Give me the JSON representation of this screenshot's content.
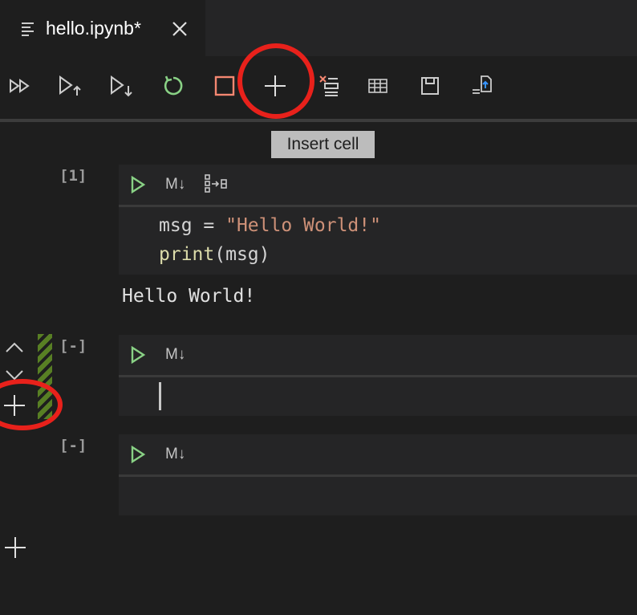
{
  "tab": {
    "title": "hello.ipynb*",
    "icon": "list-lines-icon",
    "close_icon": "close-icon"
  },
  "toolbar": {
    "buttons": [
      {
        "name": "run-all-icon"
      },
      {
        "name": "run-above-icon"
      },
      {
        "name": "run-below-icon"
      },
      {
        "name": "restart-kernel-icon",
        "color": "#89d185"
      },
      {
        "name": "interrupt-kernel-icon",
        "color": "#f48771"
      },
      {
        "name": "insert-cell-icon"
      },
      {
        "name": "clear-outputs-icon"
      },
      {
        "name": "variables-icon"
      },
      {
        "name": "save-icon"
      },
      {
        "name": "export-icon"
      }
    ],
    "tooltip": "Insert cell"
  },
  "cells": [
    {
      "exec_count": "[1]",
      "markdown_toggle": "M↓",
      "code_lines": [
        {
          "tokens": [
            {
              "text": "msg",
              "color": "#d4d4d4"
            },
            {
              "text": " = ",
              "color": "#d4d4d4"
            },
            {
              "text": "\"Hello World!\"",
              "color": "#ce9178"
            }
          ]
        },
        {
          "tokens": [
            {
              "text": "print",
              "color": "#dcdcaa"
            },
            {
              "text": "(msg)",
              "color": "#d4d4d4"
            }
          ]
        }
      ],
      "output": "Hello World!"
    },
    {
      "exec_count": "[-]",
      "markdown_toggle": "M↓"
    },
    {
      "exec_count": "[-]",
      "markdown_toggle": "M↓"
    }
  ],
  "colors": {
    "accent_run": "#89d185",
    "annotation_red": "#e8211b",
    "selected_stripe": "#587f24"
  }
}
